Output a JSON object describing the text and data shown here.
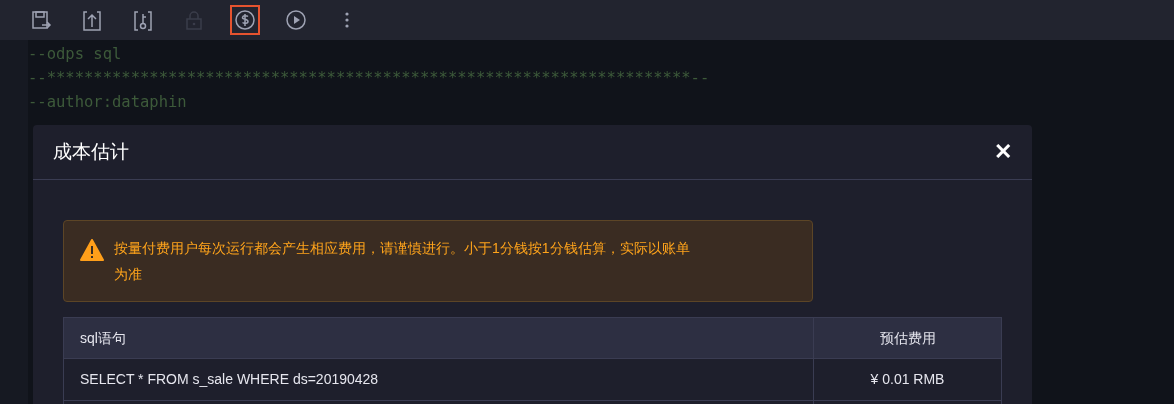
{
  "toolbar": {
    "items": [
      {
        "kind": "save",
        "disabled": false,
        "selected": false
      },
      {
        "kind": "upload",
        "disabled": false,
        "selected": false
      },
      {
        "kind": "key",
        "disabled": false,
        "selected": false
      },
      {
        "kind": "lock",
        "disabled": true,
        "selected": false
      },
      {
        "kind": "cost",
        "disabled": false,
        "selected": true
      },
      {
        "kind": "run",
        "disabled": false,
        "selected": false
      },
      {
        "kind": "more",
        "disabled": false,
        "selected": false
      }
    ]
  },
  "editor": {
    "lines": [
      "--odps sql",
      "--*********************************************************************--",
      "--author:dataphin"
    ]
  },
  "dialog": {
    "title": "成本估计",
    "close": "✕",
    "alert": {
      "text": "按量付费用户每次运行都会产生相应费用，请谨慎进行。小于1分钱按1分钱估算，实际以账单为准"
    },
    "table": {
      "columns": [
        "sql语句",
        "预估费用"
      ],
      "rows": [
        [
          "SELECT * FROM s_sale WHERE ds=20190428",
          "¥ 0.01 RMB"
        ]
      ]
    }
  }
}
